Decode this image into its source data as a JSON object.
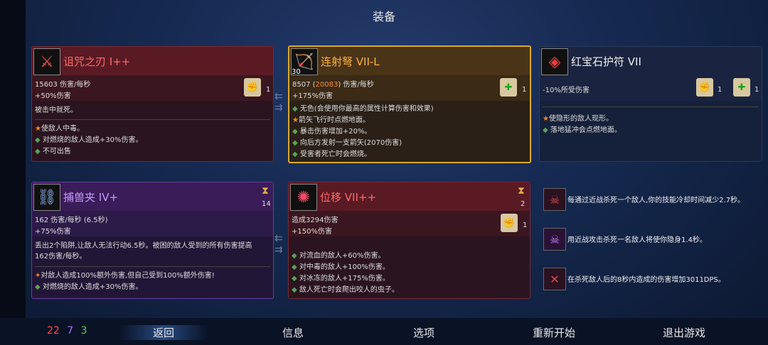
{
  "title": "装备",
  "cards": {
    "curse_blade": {
      "name": "诅咒之刃  I++",
      "icon": "cursed-sword-icon",
      "stat1": "15603  伤害/每秒",
      "stat2": "+50%伤害",
      "scroll_count": "1",
      "desc": "被击中就死。",
      "affixes": [
        "使敌人中毒。",
        "对燃烧的敌人造成+30%伤害。",
        "不可出售"
      ]
    },
    "crossbow": {
      "name": "连射弩  VII-L",
      "icon": "crossbow-icon",
      "level": "30",
      "stat1_a": "8507 (",
      "stat1_b": "20083",
      "stat1_c": ")  伤害/每秒",
      "stat2": "+175%伤害",
      "scroll_count": "1",
      "affixes": [
        "无色(会使用你最高的属性计算伤害和效果)",
        "箭矢飞行时点燃地面。",
        "暴击伤害增加+20%。",
        "向后方发射一支箭矢(2070伤害)",
        "受害者死亡时会燃烧。"
      ]
    },
    "amulet": {
      "name": "红宝石护符  VII",
      "icon": "ruby-amulet-icon",
      "stat1": "-10%所受伤害",
      "scroll_red_count": "1",
      "scroll_green_count": "1",
      "affixes": [
        "使隐形的敌人现形。",
        "落地猛冲会点燃地面。"
      ]
    },
    "trap": {
      "name": "捕兽夹  IV+",
      "icon": "bear-trap-icon",
      "cooldown": "14",
      "stat1": "162  伤害/每秒  (6.5秒)",
      "stat2": "+75%伤害",
      "desc1": "丢出2个陷阱,让敌人无法行动6.5秒。被困的敌人受到的所有伤害提高",
      "desc2": "162伤害/每秒。",
      "affixes": [
        "对敌人造成100%额外伤害,但自己受到100%额外伤害!",
        "对燃烧的敌人造成+30%伤害。"
      ]
    },
    "teleport": {
      "name": "位移  VII++",
      "icon": "teleport-icon",
      "cooldown": "2",
      "stat1": "造成3294伤害",
      "stat2": "+150%伤害",
      "scroll_count": "1",
      "affixes": [
        "对流血的敌人+60%伤害。",
        "对中毒的敌人+100%伤害。",
        "对冰冻的敌人+175%伤害。",
        "敌人死亡时会爬出咬人的虫子。"
      ]
    }
  },
  "perks": [
    {
      "icon": "skull-kill-icon",
      "text": "每通过近战杀死一个敌人,你的技能冷却时间减少2.7秒。"
    },
    {
      "icon": "stealth-skull-icon",
      "text": "用近战攻击杀死一名敌人将使你隐身1.4秒。"
    },
    {
      "icon": "crossed-weapons-icon",
      "text": "在杀死敌人后的8秒内造成的伤害增加3011DPS。"
    }
  ],
  "counts": {
    "red": "22",
    "purple": "7",
    "green": "3"
  },
  "menu": {
    "back": "返回",
    "info": "信息",
    "options": "选项",
    "restart": "重新开始",
    "quit": "退出游戏"
  },
  "colors": {
    "red": "#ff4a4a",
    "purple": "#a86aff",
    "green": "#5ad05a",
    "gold": "#d9a92a"
  }
}
